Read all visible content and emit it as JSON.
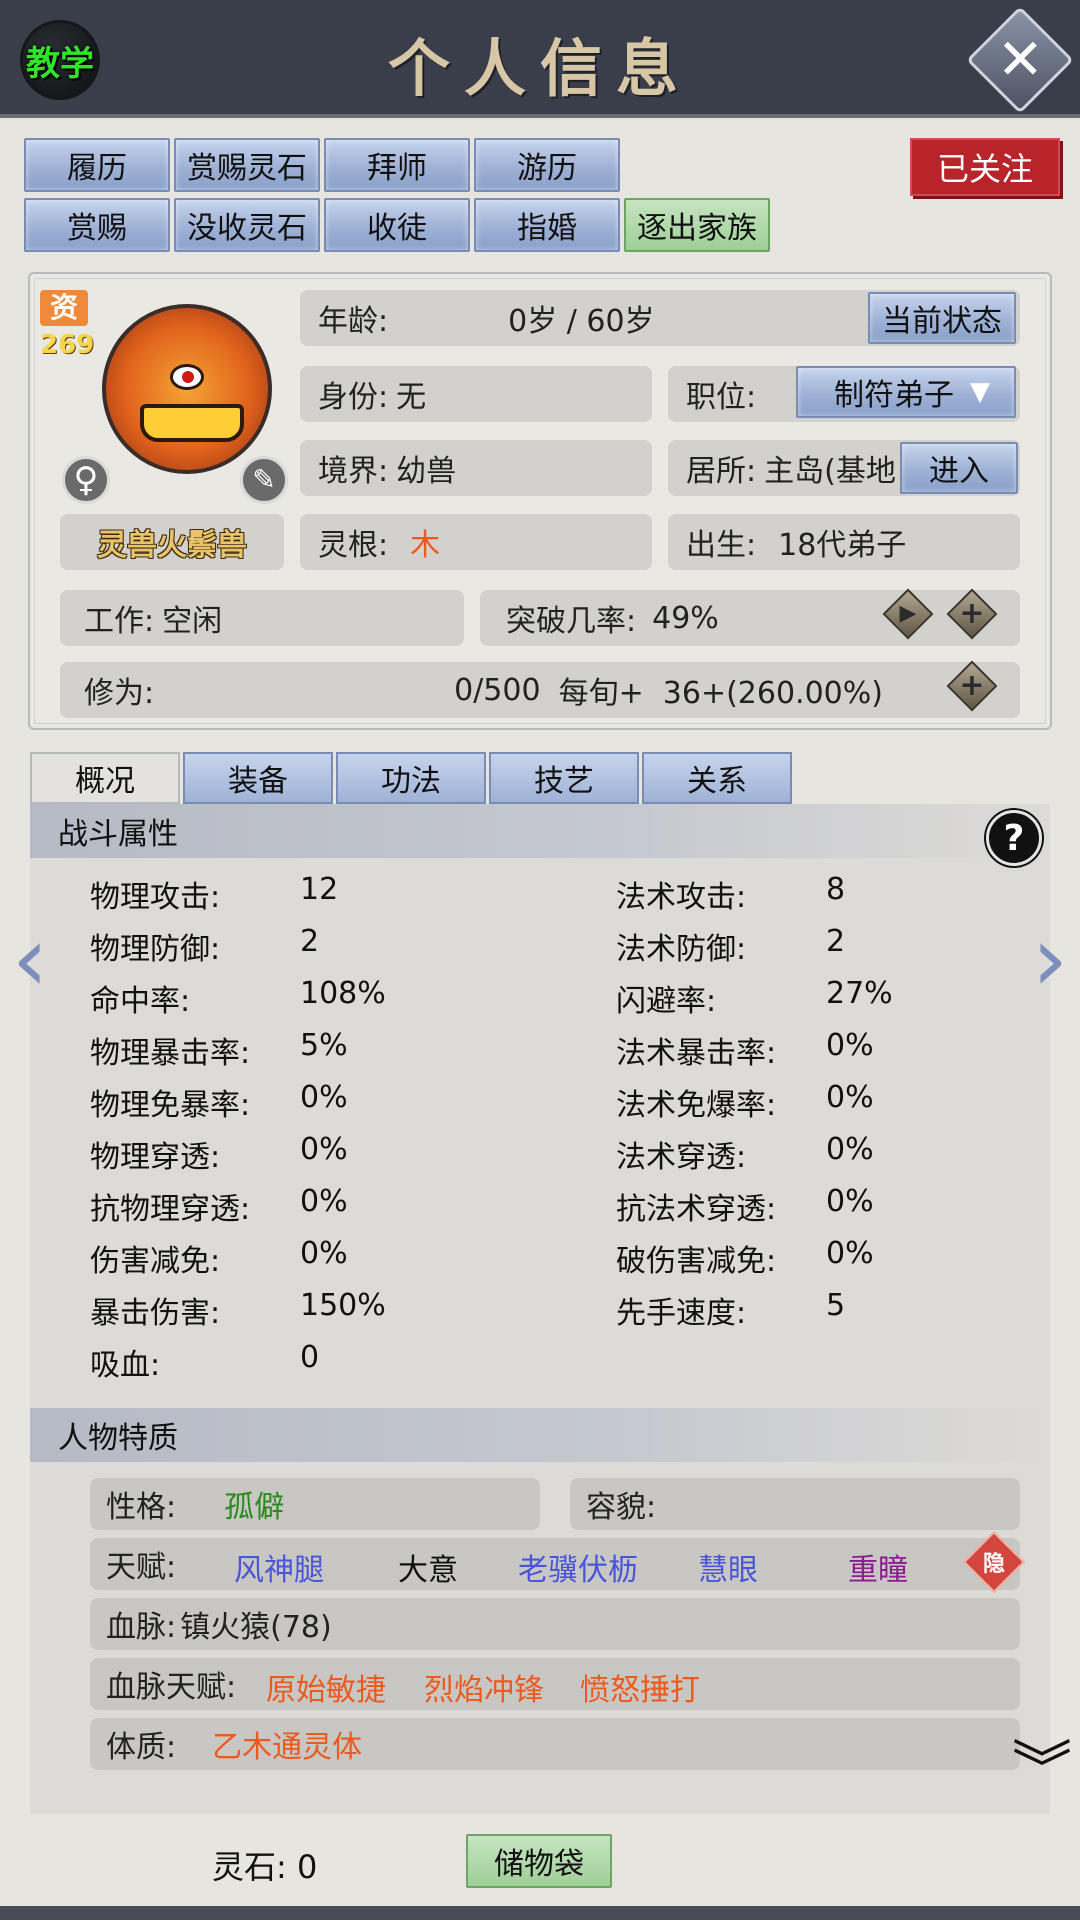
{
  "header": {
    "title": "个人信息",
    "teach_label": "教学",
    "close_icon": "close-icon"
  },
  "actions": {
    "row1": [
      "履历",
      "赏赐灵石",
      "拜师",
      "游历"
    ],
    "row2": [
      "赏赐",
      "没收灵石",
      "收徒",
      "指婚"
    ],
    "expel": "逐出家族",
    "follow": "已关注"
  },
  "profile": {
    "aptitude_label": "资",
    "aptitude_value": "269",
    "gender_icon": "female-icon",
    "name": "灵兽火鬃兽",
    "age_label": "年龄:",
    "age_value": "0岁 / 60岁",
    "status_button": "当前状态",
    "identity_label": "身份:",
    "identity_value": "无",
    "position_label": "职位:",
    "position_value": "制符弟子",
    "realm_label": "境界:",
    "realm_value": "幼兽",
    "residence_label": "居所:",
    "residence_value": "主岛(基地",
    "enter_button": "进入",
    "root_label": "灵根:",
    "root_value": "木",
    "birth_label": "出生:",
    "birth_value": "18代弟子",
    "work_label": "工作:",
    "work_value": "空闲",
    "breakthrough_label": "突破几率:",
    "breakthrough_value": "49%",
    "cultivation_label": "修为:",
    "cultivation_value": "0/500",
    "cultivation_rate": "每旬+  36+(260.00%)"
  },
  "tabs": [
    "概况",
    "装备",
    "功法",
    "技艺",
    "关系"
  ],
  "combat": {
    "title": "战斗属性",
    "left": [
      {
        "label": "物理攻击:",
        "value": "12"
      },
      {
        "label": "物理防御:",
        "value": "2"
      },
      {
        "label": "命中率:",
        "value": "108%"
      },
      {
        "label": "物理暴击率:",
        "value": "5%"
      },
      {
        "label": "物理免暴率:",
        "value": "0%"
      },
      {
        "label": "物理穿透:",
        "value": "0%"
      },
      {
        "label": "抗物理穿透:",
        "value": "0%"
      },
      {
        "label": "伤害减免:",
        "value": "0%"
      },
      {
        "label": "暴击伤害:",
        "value": "150%"
      },
      {
        "label": "吸血:",
        "value": "0"
      }
    ],
    "right": [
      {
        "label": "法术攻击:",
        "value": "8"
      },
      {
        "label": "法术防御:",
        "value": "2"
      },
      {
        "label": "闪避率:",
        "value": "27%"
      },
      {
        "label": "法术暴击率:",
        "value": "0%"
      },
      {
        "label": "法术免爆率:",
        "value": "0%"
      },
      {
        "label": "法术穿透:",
        "value": "0%"
      },
      {
        "label": "抗法术穿透:",
        "value": "0%"
      },
      {
        "label": "破伤害减免:",
        "value": "0%"
      },
      {
        "label": "先手速度:",
        "value": "5"
      }
    ]
  },
  "traits": {
    "title": "人物特质",
    "personality_label": "性格:",
    "personality_value": "孤僻",
    "looks_label": "容貌:",
    "looks_value": "",
    "talent_label": "天赋:",
    "talents": [
      "风神腿",
      "大意",
      "老骥伏枥",
      "慧眼",
      "重瞳"
    ],
    "hidden_badge": "隐",
    "bloodline_label": "血脉:",
    "bloodline_value": "镇火猿(78)",
    "bloodline_talent_label": "血脉天赋:",
    "bloodline_talents": [
      "原始敏捷",
      "烈焰冲锋",
      "愤怒捶打"
    ],
    "physique_label": "体质:",
    "physique_value": "乙木通灵体"
  },
  "footer": {
    "spirit_stone": "灵石: 0",
    "bag": "储物袋"
  },
  "colors": {
    "header_bg": "#3a3e4a",
    "button_blue": "#9fb2d6",
    "button_green": "#9fcf97",
    "follow_red": "#b8242a",
    "green_text": "#2b8a1f",
    "blue_text": "#4b55d8",
    "purple_text": "#8a1c8f",
    "orange_text": "#ec5a1e"
  }
}
